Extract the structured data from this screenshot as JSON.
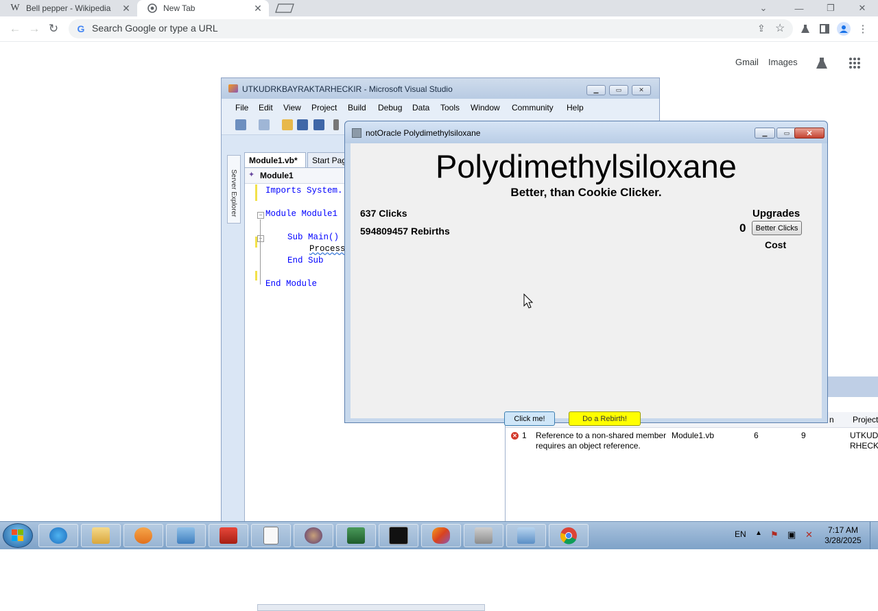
{
  "browser": {
    "tabs": [
      {
        "title": "Bell pepper - Wikipedia",
        "icon": "W"
      },
      {
        "title": "New Tab",
        "icon": "chrome-icon"
      }
    ],
    "omnibox_placeholder": "Search Google or type a URL",
    "ntp_links": {
      "gmail": "Gmail",
      "images": "Images"
    }
  },
  "visual_studio": {
    "title": "UTKUDRKBAYRAKTARHECKIR - Microsoft Visual Studio",
    "menu": [
      "File",
      "Edit",
      "View",
      "Project",
      "Build",
      "Debug",
      "Data",
      "Tools",
      "Window",
      "Community",
      "Help"
    ],
    "side_panel": "Server Explorer",
    "doc_tabs": [
      "Module1.vb*",
      "Start Page"
    ],
    "nav_object": "Module1",
    "code_lines": {
      "l1": "Imports System.",
      "l2": "Module Module1",
      "l3": "Sub Main()",
      "l4": "Process",
      "l5": "End Sub",
      "l6": "End Module"
    }
  },
  "error_list": {
    "columns": {
      "line": "n",
      "project": "Project"
    },
    "rows": [
      {
        "index": "1",
        "description_l1": "Reference to a non-shared member",
        "description_l2": "requires an object reference.",
        "file": "Module1.vb",
        "line": "6",
        "column": "9",
        "project_l1": "UTKUDF",
        "project_l2": "RHECKI"
      }
    ]
  },
  "app": {
    "window_title": "notOracle Polydimethylsiloxane",
    "heading": "Polydimethylsiloxane",
    "subheading": "Better, than Cookie Clicker.",
    "clicks": "637 Clicks",
    "rebirths": "594809457 Rebirths",
    "upgrades_label": "Upgrades",
    "upgrade_count": "0",
    "better_clicks_label": "Better Clicks",
    "cost_label": "Cost",
    "click_button": "Click me!",
    "rebirth_button": "Do a Rebirth!",
    "colors": {
      "rebirth_button": "#ffff00",
      "click_button": "#cfe6f8"
    }
  },
  "taskbar": {
    "language": "EN",
    "time": "7:17 AM",
    "date": "3/28/2025"
  }
}
